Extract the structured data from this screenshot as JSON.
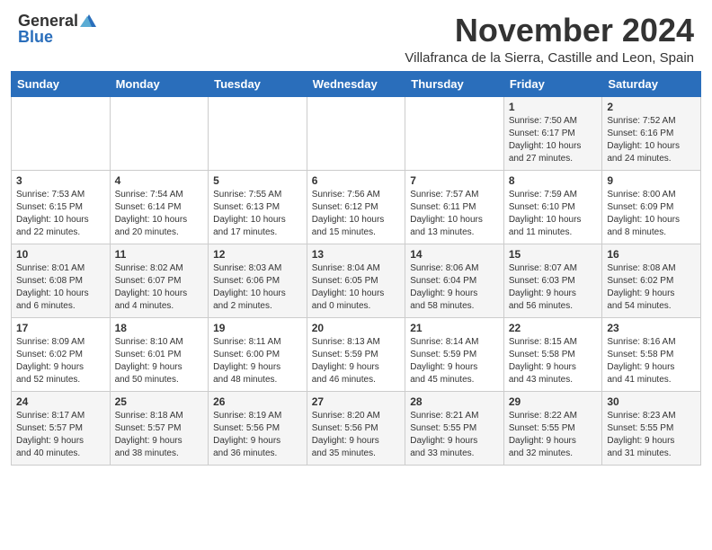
{
  "header": {
    "logo_general": "General",
    "logo_blue": "Blue",
    "month": "November 2024",
    "location": "Villafranca de la Sierra, Castille and Leon, Spain"
  },
  "weekdays": [
    "Sunday",
    "Monday",
    "Tuesday",
    "Wednesday",
    "Thursday",
    "Friday",
    "Saturday"
  ],
  "weeks": [
    [
      {
        "day": "",
        "info": ""
      },
      {
        "day": "",
        "info": ""
      },
      {
        "day": "",
        "info": ""
      },
      {
        "day": "",
        "info": ""
      },
      {
        "day": "",
        "info": ""
      },
      {
        "day": "1",
        "info": "Sunrise: 7:50 AM\nSunset: 6:17 PM\nDaylight: 10 hours\nand 27 minutes."
      },
      {
        "day": "2",
        "info": "Sunrise: 7:52 AM\nSunset: 6:16 PM\nDaylight: 10 hours\nand 24 minutes."
      }
    ],
    [
      {
        "day": "3",
        "info": "Sunrise: 7:53 AM\nSunset: 6:15 PM\nDaylight: 10 hours\nand 22 minutes."
      },
      {
        "day": "4",
        "info": "Sunrise: 7:54 AM\nSunset: 6:14 PM\nDaylight: 10 hours\nand 20 minutes."
      },
      {
        "day": "5",
        "info": "Sunrise: 7:55 AM\nSunset: 6:13 PM\nDaylight: 10 hours\nand 17 minutes."
      },
      {
        "day": "6",
        "info": "Sunrise: 7:56 AM\nSunset: 6:12 PM\nDaylight: 10 hours\nand 15 minutes."
      },
      {
        "day": "7",
        "info": "Sunrise: 7:57 AM\nSunset: 6:11 PM\nDaylight: 10 hours\nand 13 minutes."
      },
      {
        "day": "8",
        "info": "Sunrise: 7:59 AM\nSunset: 6:10 PM\nDaylight: 10 hours\nand 11 minutes."
      },
      {
        "day": "9",
        "info": "Sunrise: 8:00 AM\nSunset: 6:09 PM\nDaylight: 10 hours\nand 8 minutes."
      }
    ],
    [
      {
        "day": "10",
        "info": "Sunrise: 8:01 AM\nSunset: 6:08 PM\nDaylight: 10 hours\nand 6 minutes."
      },
      {
        "day": "11",
        "info": "Sunrise: 8:02 AM\nSunset: 6:07 PM\nDaylight: 10 hours\nand 4 minutes."
      },
      {
        "day": "12",
        "info": "Sunrise: 8:03 AM\nSunset: 6:06 PM\nDaylight: 10 hours\nand 2 minutes."
      },
      {
        "day": "13",
        "info": "Sunrise: 8:04 AM\nSunset: 6:05 PM\nDaylight: 10 hours\nand 0 minutes."
      },
      {
        "day": "14",
        "info": "Sunrise: 8:06 AM\nSunset: 6:04 PM\nDaylight: 9 hours\nand 58 minutes."
      },
      {
        "day": "15",
        "info": "Sunrise: 8:07 AM\nSunset: 6:03 PM\nDaylight: 9 hours\nand 56 minutes."
      },
      {
        "day": "16",
        "info": "Sunrise: 8:08 AM\nSunset: 6:02 PM\nDaylight: 9 hours\nand 54 minutes."
      }
    ],
    [
      {
        "day": "17",
        "info": "Sunrise: 8:09 AM\nSunset: 6:02 PM\nDaylight: 9 hours\nand 52 minutes."
      },
      {
        "day": "18",
        "info": "Sunrise: 8:10 AM\nSunset: 6:01 PM\nDaylight: 9 hours\nand 50 minutes."
      },
      {
        "day": "19",
        "info": "Sunrise: 8:11 AM\nSunset: 6:00 PM\nDaylight: 9 hours\nand 48 minutes."
      },
      {
        "day": "20",
        "info": "Sunrise: 8:13 AM\nSunset: 5:59 PM\nDaylight: 9 hours\nand 46 minutes."
      },
      {
        "day": "21",
        "info": "Sunrise: 8:14 AM\nSunset: 5:59 PM\nDaylight: 9 hours\nand 45 minutes."
      },
      {
        "day": "22",
        "info": "Sunrise: 8:15 AM\nSunset: 5:58 PM\nDaylight: 9 hours\nand 43 minutes."
      },
      {
        "day": "23",
        "info": "Sunrise: 8:16 AM\nSunset: 5:58 PM\nDaylight: 9 hours\nand 41 minutes."
      }
    ],
    [
      {
        "day": "24",
        "info": "Sunrise: 8:17 AM\nSunset: 5:57 PM\nDaylight: 9 hours\nand 40 minutes."
      },
      {
        "day": "25",
        "info": "Sunrise: 8:18 AM\nSunset: 5:57 PM\nDaylight: 9 hours\nand 38 minutes."
      },
      {
        "day": "26",
        "info": "Sunrise: 8:19 AM\nSunset: 5:56 PM\nDaylight: 9 hours\nand 36 minutes."
      },
      {
        "day": "27",
        "info": "Sunrise: 8:20 AM\nSunset: 5:56 PM\nDaylight: 9 hours\nand 35 minutes."
      },
      {
        "day": "28",
        "info": "Sunrise: 8:21 AM\nSunset: 5:55 PM\nDaylight: 9 hours\nand 33 minutes."
      },
      {
        "day": "29",
        "info": "Sunrise: 8:22 AM\nSunset: 5:55 PM\nDaylight: 9 hours\nand 32 minutes."
      },
      {
        "day": "30",
        "info": "Sunrise: 8:23 AM\nSunset: 5:55 PM\nDaylight: 9 hours\nand 31 minutes."
      }
    ]
  ]
}
